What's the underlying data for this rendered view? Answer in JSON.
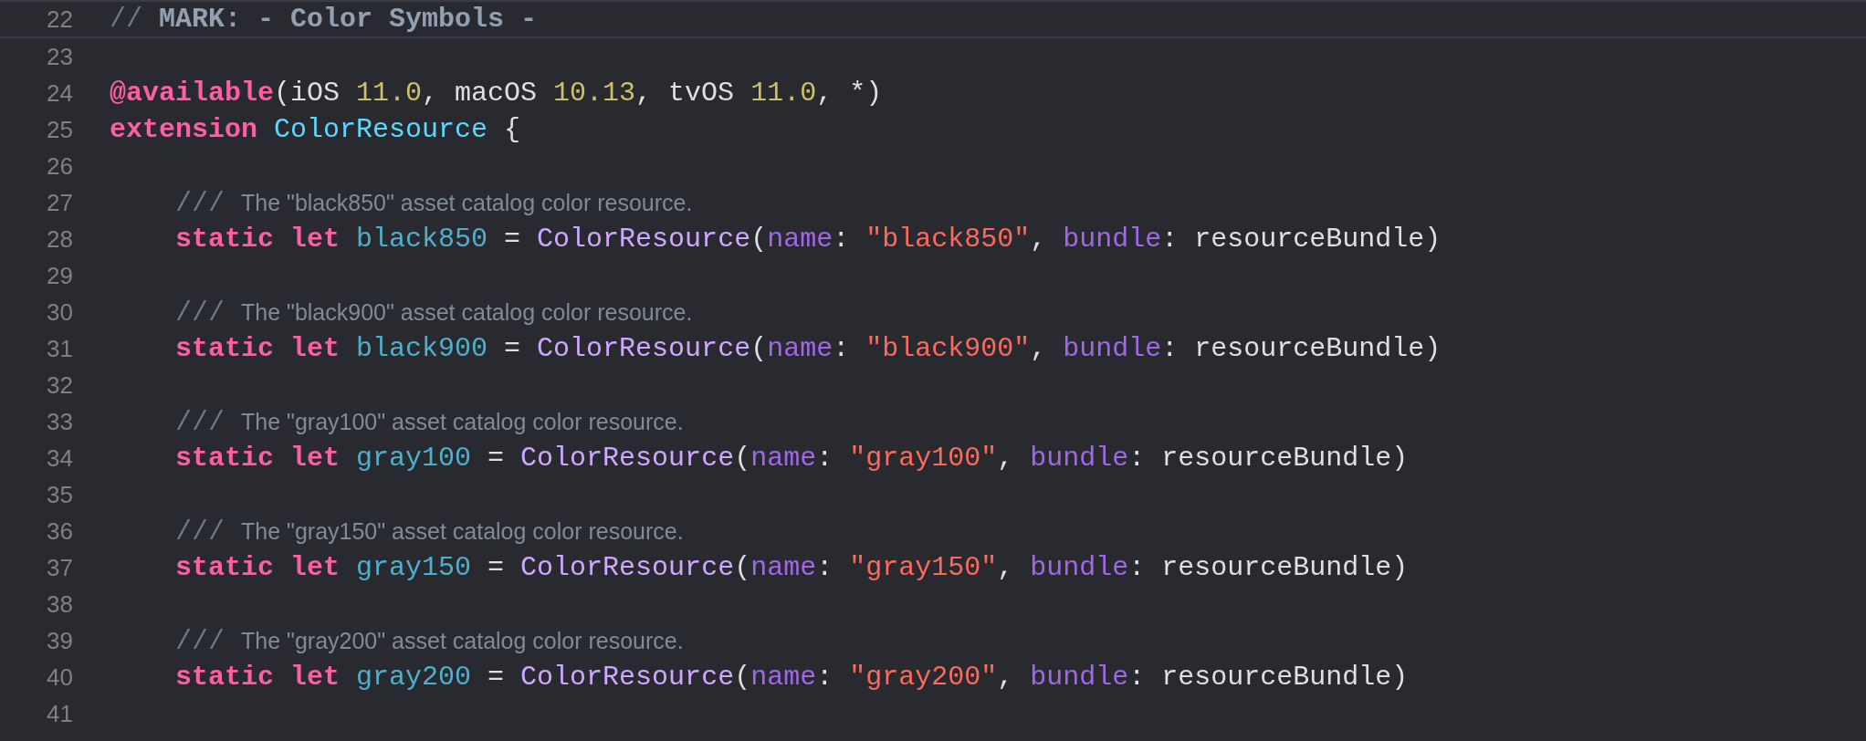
{
  "editor": {
    "lines": [
      {
        "number": "22",
        "kind": "mark",
        "tokens": [
          {
            "kind": "comment-marker",
            "text": "// "
          },
          {
            "kind": "mark",
            "text": "MARK: - Color Symbols -"
          }
        ]
      },
      {
        "number": "23"
      },
      {
        "number": "24",
        "tokens": [
          {
            "kind": "keyword",
            "text": "@available"
          },
          {
            "kind": "plain",
            "text": "(iOS "
          },
          {
            "kind": "number",
            "text": "11.0"
          },
          {
            "kind": "plain",
            "text": ", macOS "
          },
          {
            "kind": "number",
            "text": "10.13"
          },
          {
            "kind": "plain",
            "text": ", tvOS "
          },
          {
            "kind": "number",
            "text": "11.0"
          },
          {
            "kind": "plain",
            "text": ", *)"
          }
        ]
      },
      {
        "number": "25",
        "tokens": [
          {
            "kind": "keyword",
            "text": "extension "
          },
          {
            "kind": "type-decl",
            "text": "ColorResource"
          },
          {
            "kind": "plain",
            "text": " {"
          }
        ],
        "children": [
          {
            "number": "26"
          },
          {
            "number": "27",
            "tokens": [
              {
                "kind": "comment-marker",
                "text": "/// "
              },
              {
                "kind": "comment",
                "text": "The \"black850\" asset catalog color resource."
              }
            ]
          },
          {
            "number": "28",
            "tokens": [
              {
                "kind": "keyword",
                "text": "static let "
              },
              {
                "kind": "decl",
                "text": "black850"
              },
              {
                "kind": "plain",
                "text": " = "
              },
              {
                "kind": "type",
                "text": "ColorResource"
              },
              {
                "kind": "plain",
                "text": "("
              },
              {
                "kind": "param",
                "text": "name"
              },
              {
                "kind": "plain",
                "text": ": "
              },
              {
                "kind": "string",
                "text": "\"black850\""
              },
              {
                "kind": "plain",
                "text": ", "
              },
              {
                "kind": "param",
                "text": "bundle"
              },
              {
                "kind": "plain",
                "text": ": resourceBundle)"
              }
            ]
          },
          {
            "number": "29"
          },
          {
            "number": "30",
            "tokens": [
              {
                "kind": "comment-marker",
                "text": "/// "
              },
              {
                "kind": "comment",
                "text": "The \"black900\" asset catalog color resource."
              }
            ]
          },
          {
            "number": "31",
            "tokens": [
              {
                "kind": "keyword",
                "text": "static let "
              },
              {
                "kind": "decl",
                "text": "black900"
              },
              {
                "kind": "plain",
                "text": " = "
              },
              {
                "kind": "type",
                "text": "ColorResource"
              },
              {
                "kind": "plain",
                "text": "("
              },
              {
                "kind": "param",
                "text": "name"
              },
              {
                "kind": "plain",
                "text": ": "
              },
              {
                "kind": "string",
                "text": "\"black900\""
              },
              {
                "kind": "plain",
                "text": ", "
              },
              {
                "kind": "param",
                "text": "bundle"
              },
              {
                "kind": "plain",
                "text": ": resourceBundle)"
              }
            ]
          },
          {
            "number": "32"
          },
          {
            "number": "33",
            "tokens": [
              {
                "kind": "comment-marker",
                "text": "/// "
              },
              {
                "kind": "comment",
                "text": "The \"gray100\" asset catalog color resource."
              }
            ]
          },
          {
            "number": "34",
            "tokens": [
              {
                "kind": "keyword",
                "text": "static let "
              },
              {
                "kind": "decl",
                "text": "gray100"
              },
              {
                "kind": "plain",
                "text": " = "
              },
              {
                "kind": "type",
                "text": "ColorResource"
              },
              {
                "kind": "plain",
                "text": "("
              },
              {
                "kind": "param",
                "text": "name"
              },
              {
                "kind": "plain",
                "text": ": "
              },
              {
                "kind": "string",
                "text": "\"gray100\""
              },
              {
                "kind": "plain",
                "text": ", "
              },
              {
                "kind": "param",
                "text": "bundle"
              },
              {
                "kind": "plain",
                "text": ": resourceBundle)"
              }
            ]
          },
          {
            "number": "35"
          },
          {
            "number": "36",
            "tokens": [
              {
                "kind": "comment-marker",
                "text": "/// "
              },
              {
                "kind": "comment",
                "text": "The \"gray150\" asset catalog color resource."
              }
            ]
          },
          {
            "number": "37",
            "tokens": [
              {
                "kind": "keyword",
                "text": "static let "
              },
              {
                "kind": "decl",
                "text": "gray150"
              },
              {
                "kind": "plain",
                "text": " = "
              },
              {
                "kind": "type",
                "text": "ColorResource"
              },
              {
                "kind": "plain",
                "text": "("
              },
              {
                "kind": "param",
                "text": "name"
              },
              {
                "kind": "plain",
                "text": ": "
              },
              {
                "kind": "string",
                "text": "\"gray150\""
              },
              {
                "kind": "plain",
                "text": ", "
              },
              {
                "kind": "param",
                "text": "bundle"
              },
              {
                "kind": "plain",
                "text": ": resourceBundle)"
              }
            ]
          },
          {
            "number": "38"
          },
          {
            "number": "39",
            "tokens": [
              {
                "kind": "comment-marker",
                "text": "/// "
              },
              {
                "kind": "comment",
                "text": "The \"gray200\" asset catalog color resource."
              }
            ]
          },
          {
            "number": "40",
            "tokens": [
              {
                "kind": "keyword",
                "text": "static let "
              },
              {
                "kind": "decl",
                "text": "gray200"
              },
              {
                "kind": "plain",
                "text": " = "
              },
              {
                "kind": "type",
                "text": "ColorResource"
              },
              {
                "kind": "plain",
                "text": "("
              },
              {
                "kind": "param",
                "text": "name"
              },
              {
                "kind": "plain",
                "text": ": "
              },
              {
                "kind": "string",
                "text": "\"gray200\""
              },
              {
                "kind": "plain",
                "text": ", "
              },
              {
                "kind": "param",
                "text": "bundle"
              },
              {
                "kind": "plain",
                "text": ": resourceBundle)"
              }
            ]
          },
          {
            "number": "41"
          }
        ]
      }
    ]
  }
}
